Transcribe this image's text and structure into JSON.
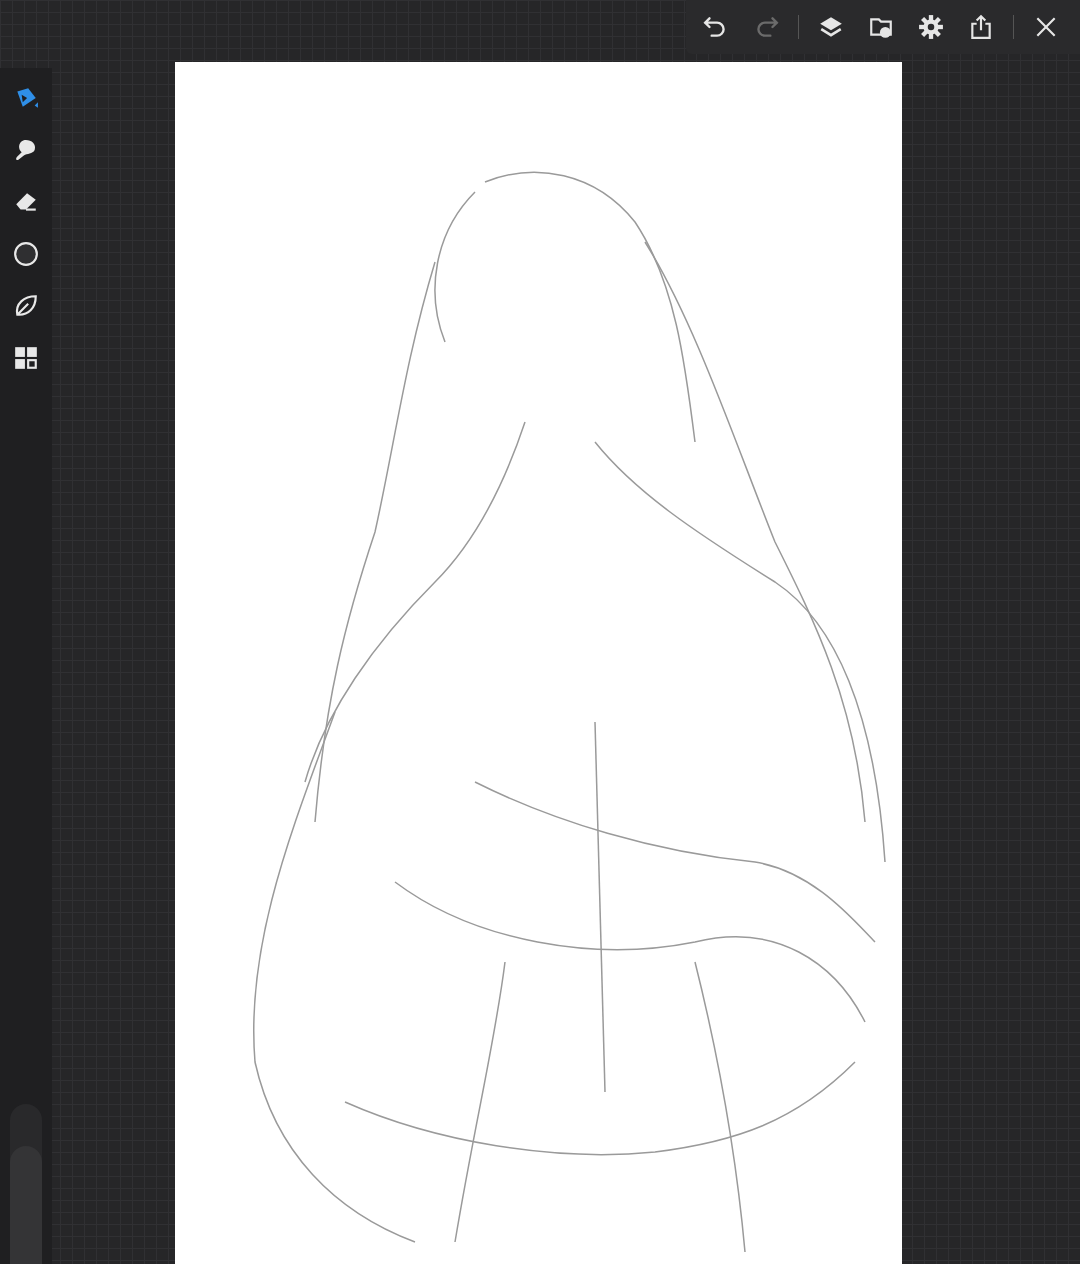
{
  "toolbar": [
    {
      "kind": "undo",
      "disabled": false
    },
    {
      "kind": "redo",
      "disabled": true
    },
    {
      "kind": "separator"
    },
    {
      "kind": "layers",
      "disabled": false
    },
    {
      "kind": "import",
      "disabled": false
    },
    {
      "kind": "settings",
      "disabled": false
    },
    {
      "kind": "share",
      "disabled": false
    },
    {
      "kind": "separator"
    },
    {
      "kind": "close",
      "disabled": false
    }
  ],
  "brush_size": {
    "level": 0.74
  },
  "tools": [
    {
      "kind": "brush",
      "selected": true
    },
    {
      "kind": "smudge",
      "selected": false
    },
    {
      "kind": "eraser",
      "selected": false
    },
    {
      "kind": "color",
      "selected": false
    },
    {
      "kind": "selection",
      "selected": false
    },
    {
      "kind": "gallery",
      "selected": false
    }
  ]
}
